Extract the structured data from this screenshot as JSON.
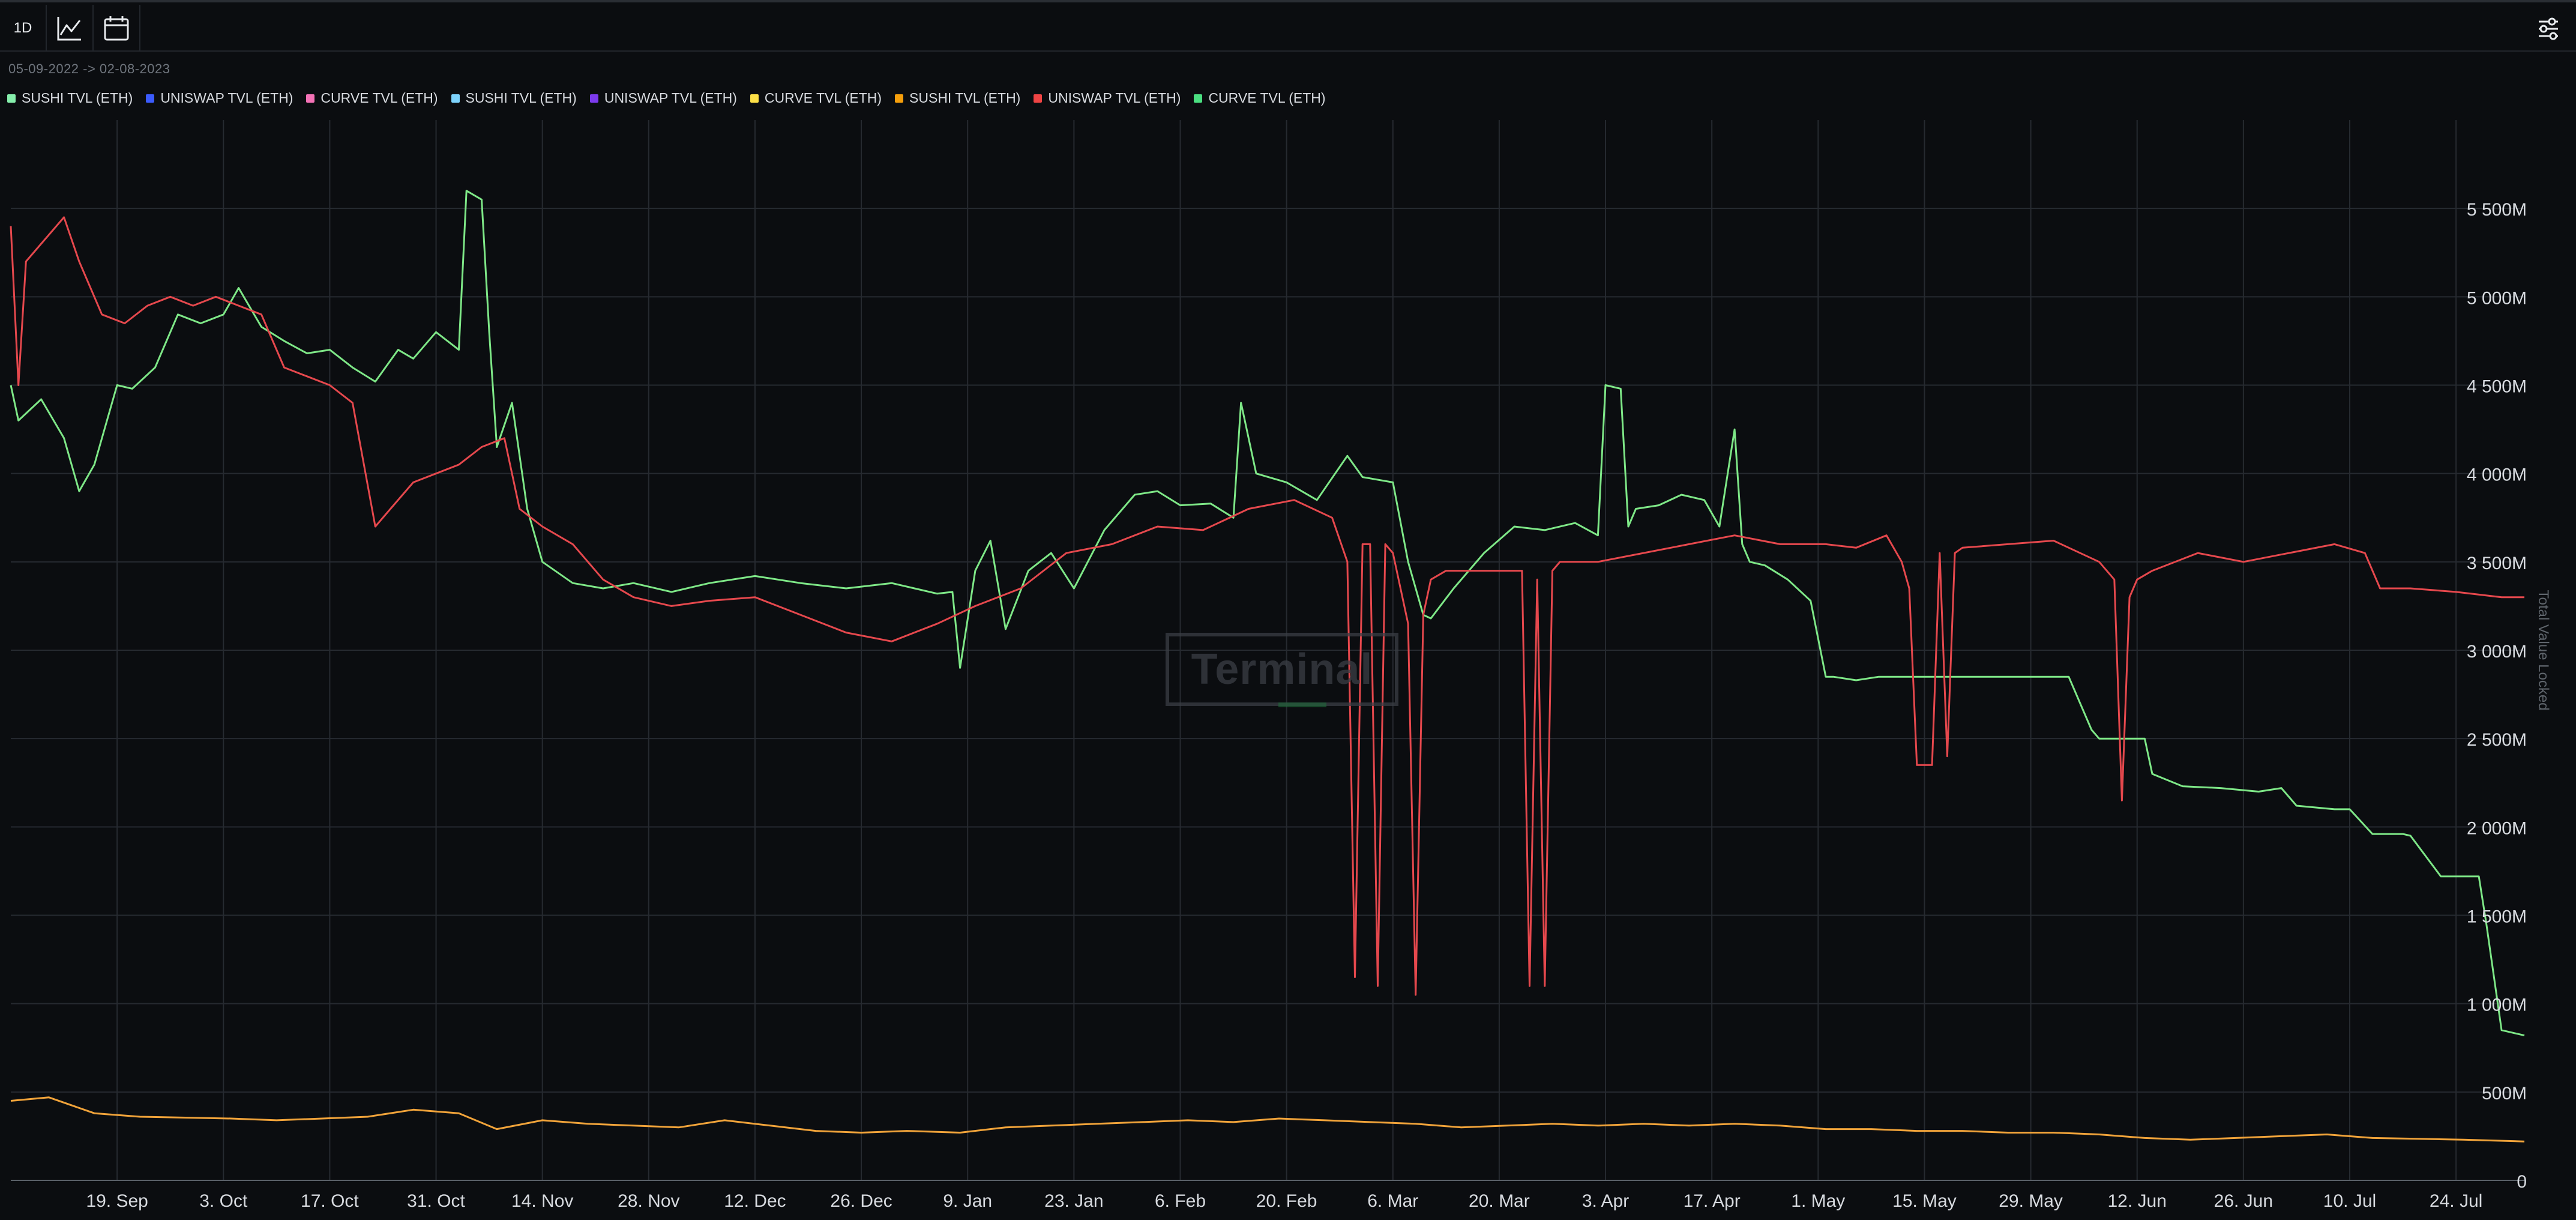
{
  "toolbar": {
    "interval_label": "1D"
  },
  "date_range": "05-09-2022 -> 02-08-2023",
  "colors": {
    "background": "#0b0d10",
    "grid": "#262a30",
    "sushi": "#7ee787",
    "uniswap": "#e5484d",
    "curve_green": "#58c27a",
    "orange": "#f0a33a"
  },
  "legend": [
    {
      "label": "SUSHI TVL (ETH)",
      "color": "#86efac"
    },
    {
      "label": "UNISWAP TVL (ETH)",
      "color": "#3b5bfd"
    },
    {
      "label": "CURVE TVL (ETH)",
      "color": "#f472b6"
    },
    {
      "label": "SUSHI TVL (ETH)",
      "color": "#7dd3fc"
    },
    {
      "label": "UNISWAP TVL (ETH)",
      "color": "#7c3aed"
    },
    {
      "label": "CURVE TVL (ETH)",
      "color": "#fde047"
    },
    {
      "label": "SUSHI TVL (ETH)",
      "color": "#f59e0b"
    },
    {
      "label": "UNISWAP TVL (ETH)",
      "color": "#ef4444"
    },
    {
      "label": "CURVE TVL (ETH)",
      "color": "#4ade80"
    }
  ],
  "watermark": "Terminal",
  "chart_data": {
    "type": "line",
    "xlabel": "",
    "ylabel": "Total Value Locked",
    "ylim": [
      0,
      6000
    ],
    "xlim": [
      "2022-09-05",
      "2023-08-02"
    ],
    "grid": true,
    "legend_position": "top-left",
    "x_ticks": [
      "19. Sep",
      "3. Oct",
      "17. Oct",
      "31. Oct",
      "14. Nov",
      "28. Nov",
      "12. Dec",
      "26. Dec",
      "9. Jan",
      "23. Jan",
      "6. Feb",
      "20. Feb",
      "6. Mar",
      "20. Mar",
      "3. Apr",
      "17. Apr",
      "1. May",
      "15. May",
      "29. May",
      "12. Jun",
      "26. Jun",
      "10. Jul",
      "24. Jul"
    ],
    "y_ticks": [
      "0",
      "500M",
      "1 000M",
      "1 500M",
      "2 000M",
      "2 500M",
      "3 000M",
      "3 500M",
      "4 000M",
      "4 500M",
      "5 000M",
      "5 500M"
    ],
    "series": [
      {
        "color": "#7ee787",
        "x": [
          "2022-09-05",
          "2022-09-06",
          "2022-09-09",
          "2022-09-12",
          "2022-09-14",
          "2022-09-16",
          "2022-09-19",
          "2022-09-21",
          "2022-09-24",
          "2022-09-27",
          "2022-09-30",
          "2022-10-03",
          "2022-10-05",
          "2022-10-08",
          "2022-10-11",
          "2022-10-14",
          "2022-10-17",
          "2022-10-20",
          "2022-10-23",
          "2022-10-26",
          "2022-10-28",
          "2022-10-31",
          "2022-11-03",
          "2022-11-04",
          "2022-11-06",
          "2022-11-07",
          "2022-11-08",
          "2022-11-10",
          "2022-11-12",
          "2022-11-14",
          "2022-11-18",
          "2022-11-22",
          "2022-11-26",
          "2022-12-01",
          "2022-12-06",
          "2022-12-12",
          "2022-12-18",
          "2022-12-24",
          "2022-12-30",
          "2023-01-05",
          "2023-01-07",
          "2023-01-08",
          "2023-01-10",
          "2023-01-12",
          "2023-01-14",
          "2023-01-17",
          "2023-01-20",
          "2023-01-23",
          "2023-01-27",
          "2023-01-31",
          "2023-02-03",
          "2023-02-06",
          "2023-02-10",
          "2023-02-13",
          "2023-02-14",
          "2023-02-16",
          "2023-02-20",
          "2023-02-24",
          "2023-02-28",
          "2023-03-02",
          "2023-03-06",
          "2023-03-08",
          "2023-03-10",
          "2023-03-11",
          "2023-03-14",
          "2023-03-18",
          "2023-03-22",
          "2023-03-26",
          "2023-03-30",
          "2023-04-02",
          "2023-04-03",
          "2023-04-05",
          "2023-04-06",
          "2023-04-07",
          "2023-04-10",
          "2023-04-13",
          "2023-04-16",
          "2023-04-18",
          "2023-04-20",
          "2023-04-21",
          "2023-04-22",
          "2023-04-24",
          "2023-04-27",
          "2023-04-30",
          "2023-05-02",
          "2023-05-03",
          "2023-05-06",
          "2023-05-09",
          "2023-05-13",
          "2023-05-20",
          "2023-05-27",
          "2023-06-03",
          "2023-06-06",
          "2023-06-07",
          "2023-06-09",
          "2023-06-13",
          "2023-06-14",
          "2023-06-18",
          "2023-06-23",
          "2023-06-28",
          "2023-07-01",
          "2023-07-03",
          "2023-07-08",
          "2023-07-10",
          "2023-07-13",
          "2023-07-17",
          "2023-07-18",
          "2023-07-22",
          "2023-07-24",
          "2023-07-25",
          "2023-07-27",
          "2023-07-28",
          "2023-07-30",
          "2023-08-02"
        ],
        "values": [
          4500,
          4300,
          4420,
          4200,
          3900,
          4050,
          4500,
          4480,
          4600,
          4900,
          4850,
          4900,
          5050,
          4830,
          4750,
          4680,
          4700,
          4600,
          4520,
          4700,
          4650,
          4800,
          4700,
          5600,
          5550,
          4800,
          4150,
          4400,
          3800,
          3500,
          3380,
          3350,
          3380,
          3330,
          3380,
          3420,
          3380,
          3350,
          3380,
          3320,
          3330,
          2900,
          3450,
          3620,
          3120,
          3450,
          3550,
          3350,
          3680,
          3880,
          3900,
          3820,
          3830,
          3750,
          4400,
          4000,
          3950,
          3850,
          4100,
          3980,
          3950,
          3500,
          3200,
          3180,
          3350,
          3550,
          3700,
          3680,
          3720,
          3650,
          4500,
          4480,
          3700,
          3800,
          3820,
          3880,
          3850,
          3700,
          4250,
          3600,
          3500,
          3480,
          3400,
          3280,
          2850,
          2850,
          2830,
          2850,
          2850,
          2850,
          2850,
          2850,
          2550,
          2500,
          2500,
          2500,
          2300,
          2230,
          2220,
          2200,
          2220,
          2120,
          2100,
          2100,
          1960,
          1960,
          1950,
          1720,
          1720,
          1720,
          1720,
          1450,
          850,
          820
        ]
      },
      {
        "color": "#e5484d",
        "x": [
          "2022-09-05",
          "2022-09-06",
          "2022-09-07",
          "2022-09-09",
          "2022-09-12",
          "2022-09-14",
          "2022-09-17",
          "2022-09-20",
          "2022-09-23",
          "2022-09-26",
          "2022-09-29",
          "2022-10-02",
          "2022-10-05",
          "2022-10-08",
          "2022-10-11",
          "2022-10-14",
          "2022-10-17",
          "2022-10-20",
          "2022-10-23",
          "2022-10-25",
          "2022-10-28",
          "2022-10-31",
          "2022-11-03",
          "2022-11-06",
          "2022-11-09",
          "2022-11-11",
          "2022-11-14",
          "2022-11-18",
          "2022-11-22",
          "2022-11-26",
          "2022-12-01",
          "2022-12-06",
          "2022-12-12",
          "2022-12-18",
          "2022-12-24",
          "2022-12-30",
          "2023-01-05",
          "2023-01-10",
          "2023-01-16",
          "2023-01-22",
          "2023-01-28",
          "2023-02-03",
          "2023-02-09",
          "2023-02-15",
          "2023-02-21",
          "2023-02-26",
          "2023-02-28",
          "2023-03-01",
          "2023-03-02",
          "2023-03-03",
          "2023-03-04",
          "2023-03-05",
          "2023-03-06",
          "2023-03-08",
          "2023-03-09",
          "2023-03-10",
          "2023-03-11",
          "2023-03-13",
          "2023-03-18",
          "2023-03-23",
          "2023-03-24",
          "2023-03-25",
          "2023-03-26",
          "2023-03-27",
          "2023-03-28",
          "2023-03-29",
          "2023-04-02",
          "2023-04-08",
          "2023-04-14",
          "2023-04-20",
          "2023-04-26",
          "2023-05-02",
          "2023-05-06",
          "2023-05-10",
          "2023-05-12",
          "2023-05-13",
          "2023-05-14",
          "2023-05-16",
          "2023-05-17",
          "2023-05-18",
          "2023-05-19",
          "2023-05-20",
          "2023-05-26",
          "2023-06-01",
          "2023-06-07",
          "2023-06-09",
          "2023-06-10",
          "2023-06-11",
          "2023-06-12",
          "2023-06-14",
          "2023-06-20",
          "2023-06-26",
          "2023-07-02",
          "2023-07-08",
          "2023-07-12",
          "2023-07-14",
          "2023-07-18",
          "2023-07-24",
          "2023-07-30",
          "2023-08-02"
        ],
        "values": [
          5400,
          4500,
          5200,
          5300,
          5450,
          5200,
          4900,
          4850,
          4950,
          5000,
          4950,
          5000,
          4950,
          4900,
          4600,
          4550,
          4500,
          4400,
          3700,
          3800,
          3950,
          4000,
          4050,
          4150,
          4200,
          3800,
          3700,
          3600,
          3400,
          3300,
          3250,
          3280,
          3300,
          3200,
          3100,
          3050,
          3150,
          3250,
          3350,
          3550,
          3600,
          3700,
          3680,
          3800,
          3850,
          3750,
          3500,
          1150,
          3600,
          3600,
          1100,
          3600,
          3550,
          3150,
          1050,
          3200,
          3400,
          3450,
          3450,
          3450,
          1100,
          3400,
          1100,
          3450,
          3500,
          3500,
          3500,
          3550,
          3600,
          3650,
          3600,
          3600,
          3580,
          3650,
          3500,
          3350,
          2350,
          2350,
          3550,
          2400,
          3550,
          3580,
          3600,
          3620,
          3500,
          3400,
          2150,
          3300,
          3400,
          3450,
          3550,
          3500,
          3550,
          3600,
          3550,
          3350,
          3350,
          3330,
          3300,
          3300
        ]
      },
      {
        "color": "#f0a33a",
        "x": [
          "2022-09-05",
          "2022-09-10",
          "2022-09-16",
          "2022-09-22",
          "2022-09-28",
          "2022-10-04",
          "2022-10-10",
          "2022-10-16",
          "2022-10-22",
          "2022-10-28",
          "2022-11-03",
          "2022-11-08",
          "2022-11-14",
          "2022-11-20",
          "2022-11-26",
          "2022-12-02",
          "2022-12-08",
          "2022-12-14",
          "2022-12-20",
          "2022-12-26",
          "2023-01-01",
          "2023-01-08",
          "2023-01-14",
          "2023-01-20",
          "2023-01-26",
          "2023-02-01",
          "2023-02-07",
          "2023-02-13",
          "2023-02-19",
          "2023-02-25",
          "2023-03-03",
          "2023-03-09",
          "2023-03-15",
          "2023-03-21",
          "2023-03-27",
          "2023-04-02",
          "2023-04-08",
          "2023-04-14",
          "2023-04-20",
          "2023-04-26",
          "2023-05-02",
          "2023-05-08",
          "2023-05-14",
          "2023-05-20",
          "2023-05-26",
          "2023-06-01",
          "2023-06-07",
          "2023-06-13",
          "2023-06-19",
          "2023-06-25",
          "2023-07-01",
          "2023-07-07",
          "2023-07-13",
          "2023-07-19",
          "2023-07-25",
          "2023-08-02"
        ],
        "values": [
          450,
          470,
          380,
          360,
          355,
          350,
          340,
          350,
          360,
          400,
          380,
          290,
          340,
          320,
          310,
          300,
          340,
          310,
          280,
          270,
          280,
          270,
          300,
          310,
          320,
          330,
          340,
          330,
          350,
          340,
          330,
          320,
          300,
          310,
          320,
          310,
          320,
          310,
          320,
          310,
          290,
          290,
          280,
          280,
          270,
          270,
          260,
          240,
          230,
          240,
          250,
          260,
          240,
          235,
          230,
          220
        ]
      }
    ]
  }
}
